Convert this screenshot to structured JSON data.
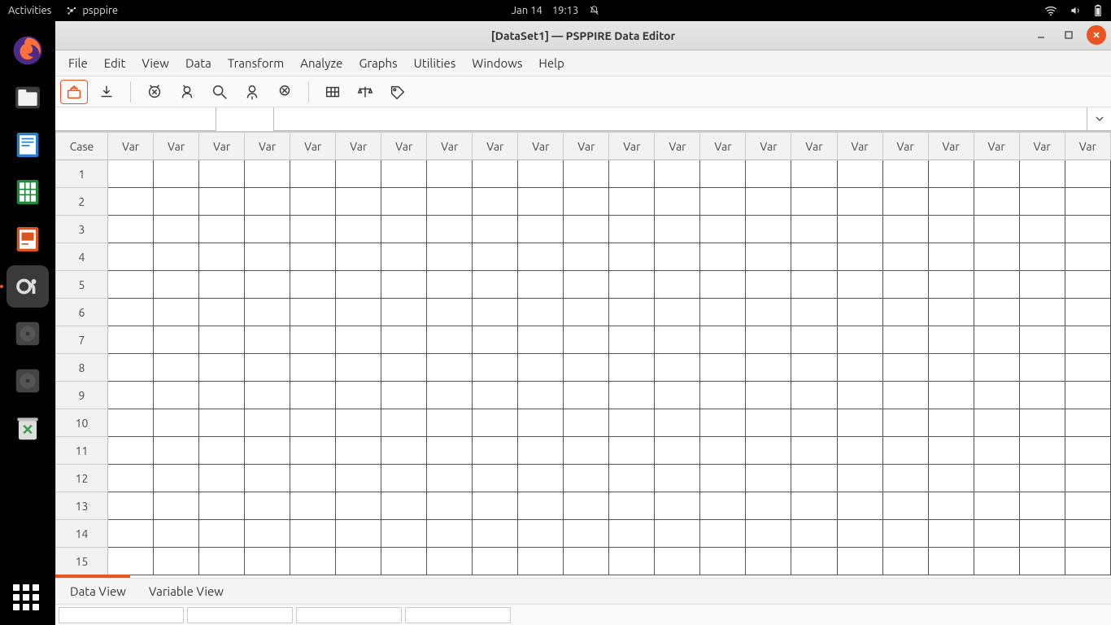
{
  "topbar": {
    "activities": "Activities",
    "appname": "psppire",
    "date": "Jan 14",
    "time": "19:13"
  },
  "window": {
    "title": "[DataSet1] — PSPPIRE Data Editor"
  },
  "menus": [
    "File",
    "Edit",
    "View",
    "Data",
    "Transform",
    "Analyze",
    "Graphs",
    "Utilities",
    "Windows",
    "Help"
  ],
  "toolbar_icons": [
    "open",
    "save",
    "goto-case",
    "goto-var",
    "search",
    "insert-case",
    "delete-case",
    "variables",
    "weights",
    "labels"
  ],
  "grid": {
    "case_header": "Case",
    "var_header": "Var",
    "num_columns": 22,
    "num_rows": 15
  },
  "tabs": {
    "data": "Data View",
    "variable": "Variable View"
  }
}
